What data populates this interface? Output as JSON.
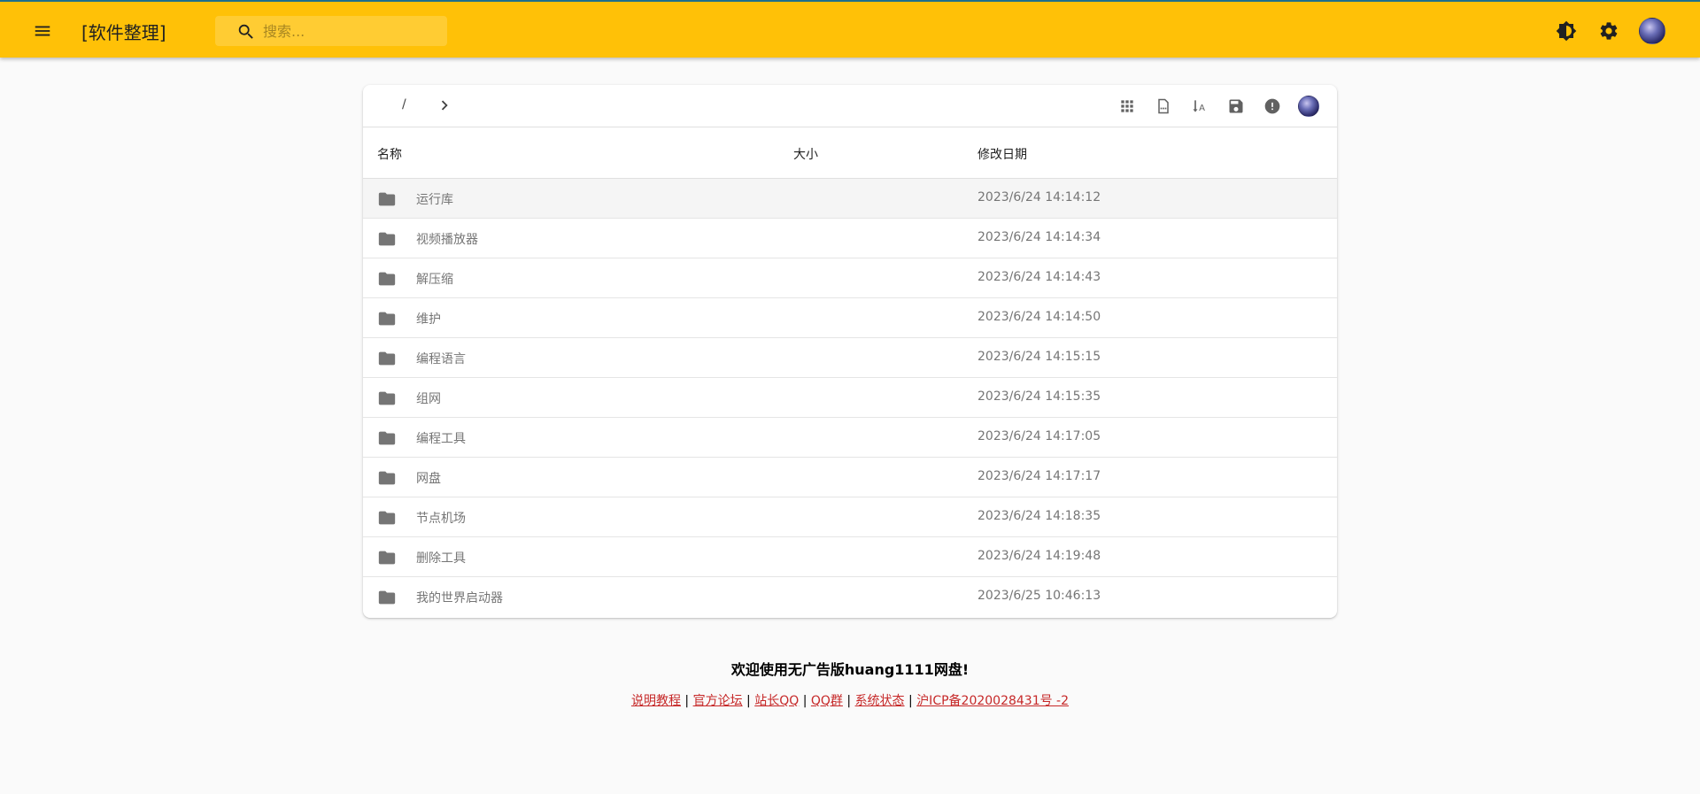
{
  "appbar": {
    "title": "[软件整理]",
    "search_placeholder": "搜索...",
    "icons": [
      "menu-icon",
      "search-icon",
      "brightness-icon",
      "settings-icon",
      "avatar"
    ]
  },
  "toolbar": {
    "breadcrumb_root": "/",
    "icons": [
      "grid-view-icon",
      "file-dotted-icon",
      "sort-alpha-icon",
      "save-icon",
      "info-icon",
      "avatar"
    ]
  },
  "table": {
    "headers": {
      "name": "名称",
      "size": "大小",
      "date": "修改日期"
    },
    "rows": [
      {
        "name": "运行库",
        "size": "",
        "date": "2023/6/24 14:14:12"
      },
      {
        "name": "视频播放器",
        "size": "",
        "date": "2023/6/24 14:14:34"
      },
      {
        "name": "解压缩",
        "size": "",
        "date": "2023/6/24 14:14:43"
      },
      {
        "name": "维护",
        "size": "",
        "date": "2023/6/24 14:14:50"
      },
      {
        "name": "编程语言",
        "size": "",
        "date": "2023/6/24 14:15:15"
      },
      {
        "name": "组网",
        "size": "",
        "date": "2023/6/24 14:15:35"
      },
      {
        "name": "编程工具",
        "size": "",
        "date": "2023/6/24 14:17:05"
      },
      {
        "name": "网盘",
        "size": "",
        "date": "2023/6/24 14:17:17"
      },
      {
        "name": "节点机场",
        "size": "",
        "date": "2023/6/24 14:18:35"
      },
      {
        "name": "删除工具",
        "size": "",
        "date": "2023/6/24 14:19:48"
      },
      {
        "name": "我的世界启动器",
        "size": "",
        "date": "2023/6/25 10:46:13"
      }
    ]
  },
  "footer": {
    "title": "欢迎使用无广告版huang1111网盘!",
    "links": [
      "说明教程",
      "官方论坛",
      "站长QQ",
      "QQ群",
      "系统状态",
      "沪ICP备2020028431号 -2"
    ],
    "separator": "|"
  },
  "colors": {
    "appbar": "#ffc107",
    "link": "#c62828",
    "folder_icon": "#757575"
  }
}
